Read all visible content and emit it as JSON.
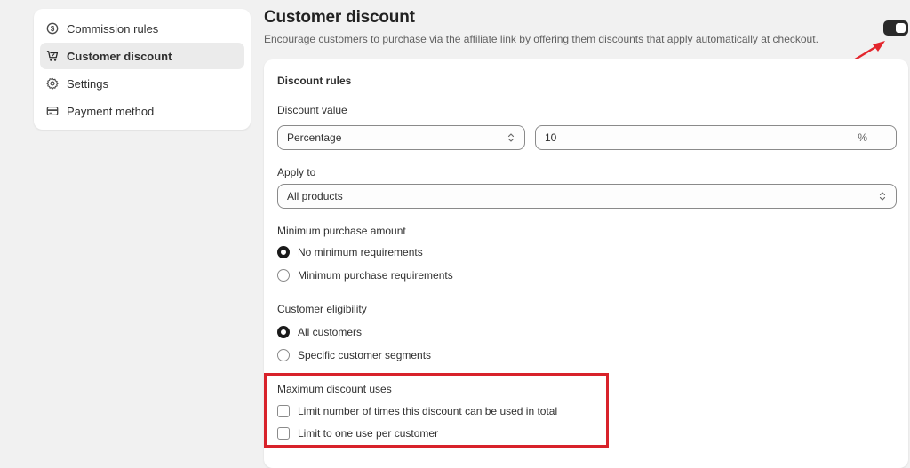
{
  "sidebar": {
    "items": [
      {
        "label": "Commission rules",
        "icon": "dollar-circle-icon",
        "active": false
      },
      {
        "label": "Customer discount",
        "icon": "cart-discount-icon",
        "active": true
      },
      {
        "label": "Settings",
        "icon": "gear-icon",
        "active": false
      },
      {
        "label": "Payment method",
        "icon": "credit-card-icon",
        "active": false
      }
    ]
  },
  "header": {
    "title": "Customer discount",
    "subtitle": "Encourage customers to purchase via the affiliate link by offering them discounts that apply automatically at checkout.",
    "toggle_enabled": true
  },
  "form": {
    "section_title": "Discount rules",
    "discount_value": {
      "label": "Discount value",
      "type_selected": "Percentage",
      "amount": "10",
      "suffix": "%"
    },
    "apply_to": {
      "label": "Apply to",
      "selected": "All products"
    },
    "minimum_purchase": {
      "label": "Minimum purchase amount",
      "options": [
        {
          "label": "No minimum requirements",
          "selected": true
        },
        {
          "label": "Minimum purchase requirements",
          "selected": false
        }
      ]
    },
    "customer_eligibility": {
      "label": "Customer eligibility",
      "options": [
        {
          "label": "All customers",
          "selected": true
        },
        {
          "label": "Specific customer segments",
          "selected": false
        }
      ]
    },
    "max_uses": {
      "label": "Maximum discount uses",
      "options": [
        {
          "label": "Limit number of times this discount can be used in total",
          "checked": false
        },
        {
          "label": "Limit to one use per customer",
          "checked": false
        }
      ]
    }
  },
  "annotations": {
    "arrow_color": "#e3262d",
    "highlight_color": "#d8222a"
  }
}
